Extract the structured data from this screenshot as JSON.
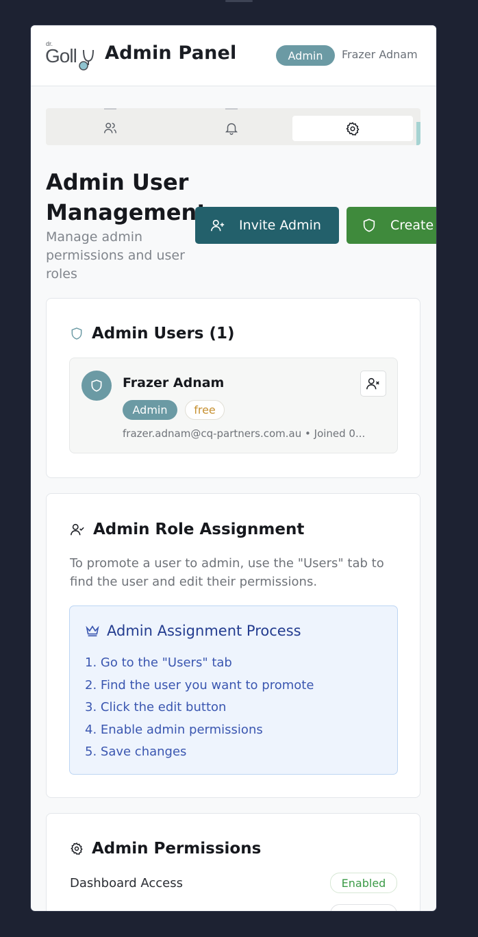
{
  "header": {
    "logo_text": "dr. Golly",
    "title": "Admin Panel",
    "role_badge": "Admin",
    "user_name": "Frazer Adnam"
  },
  "tabs": [
    {
      "icon": "users-icon",
      "active": false
    },
    {
      "icon": "bell-icon",
      "active": false
    },
    {
      "icon": "gear-icon",
      "active": true
    }
  ],
  "page": {
    "title": "Admin User Management",
    "subtitle": "Manage admin permissions and user roles"
  },
  "actions": {
    "invite_label": "Invite Admin",
    "create_label": "Create"
  },
  "admin_users": {
    "title": "Admin Users (1)",
    "users": [
      {
        "name": "Frazer Adnam",
        "role": "Admin",
        "plan": "free",
        "meta": "frazer.adnam@cq-partners.com.au • Joined 0..."
      }
    ]
  },
  "role_assignment": {
    "title": "Admin Role Assignment",
    "description": "To promote a user to admin, use the \"Users\" tab to find the user and edit their permissions.",
    "process_title": "Admin Assignment Process",
    "steps": [
      "1. Go to the \"Users\" tab",
      "2. Find the user you want to promote",
      "3. Click the edit button",
      "4. Enable admin permissions",
      "5. Save changes"
    ]
  },
  "permissions": {
    "title": "Admin Permissions",
    "items": [
      {
        "label": "Dashboard Access",
        "status": "Enabled"
      }
    ]
  },
  "colors": {
    "brand_teal": "#23606b",
    "create_green": "#3f8a3c",
    "admin_badge": "#6b9aa4",
    "process_blue": "#233c8f"
  }
}
